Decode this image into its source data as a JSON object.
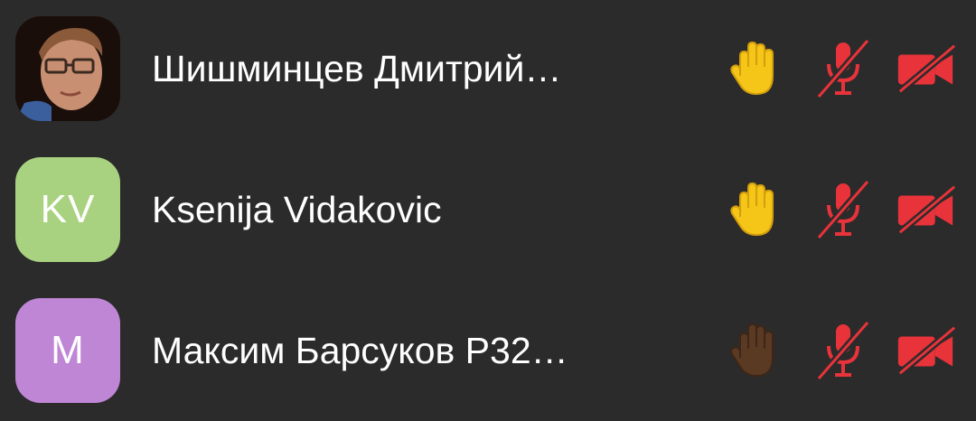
{
  "participants": [
    {
      "name": "Шишминцев Дмитрий…",
      "avatar": {
        "type": "photo",
        "initials": ""
      },
      "hand_color": "#f5c518",
      "mic_icon": "mic-off-icon",
      "camera_icon": "camera-off-icon"
    },
    {
      "name": "Ksenija Vidakovic",
      "avatar": {
        "type": "initials",
        "initials": "KV",
        "color": "#a8d27f"
      },
      "hand_color": "#f5c518",
      "mic_icon": "mic-off-icon",
      "camera_icon": "camera-off-icon"
    },
    {
      "name": "Максим Барсуков Р32…",
      "avatar": {
        "type": "initials",
        "initials": "M",
        "color": "#c086d6"
      },
      "hand_color": "#5b3a24",
      "mic_icon": "mic-off-icon",
      "camera_icon": "camera-off-icon"
    }
  ],
  "colors": {
    "background": "#2b2b2b",
    "muted_red": "#e8333a",
    "text": "#ffffff"
  }
}
